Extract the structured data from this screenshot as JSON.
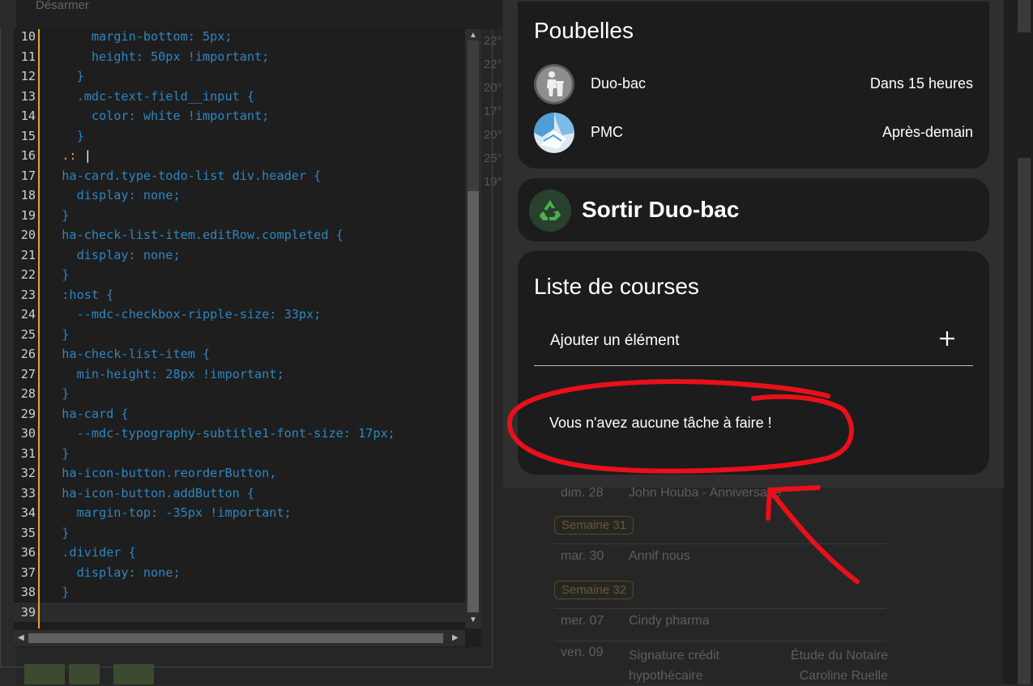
{
  "editor": {
    "lines": [
      {
        "n": "10",
        "text": "      margin-bottom: 5px;"
      },
      {
        "n": "11",
        "text": "      height: 50px !important;"
      },
      {
        "n": "12",
        "text": "    }"
      },
      {
        "n": "13",
        "text": "    .mdc-text-field__input {"
      },
      {
        "n": "14",
        "text": "      color: white !important;"
      },
      {
        "n": "15",
        "text": "    }"
      },
      {
        "n": "16",
        "text": ".: |",
        "prefix": "  "
      },
      {
        "n": "17",
        "text": "  ha-card.type-todo-list div.header {"
      },
      {
        "n": "18",
        "text": "    display: none;"
      },
      {
        "n": "19",
        "text": "  }"
      },
      {
        "n": "20",
        "text": "  ha-check-list-item.editRow.completed {"
      },
      {
        "n": "21",
        "text": "    display: none;"
      },
      {
        "n": "22",
        "text": "  }"
      },
      {
        "n": "23",
        "text": "  :host {"
      },
      {
        "n": "24",
        "text": "    --mdc-checkbox-ripple-size: 33px;"
      },
      {
        "n": "25",
        "text": "  }"
      },
      {
        "n": "26",
        "text": "  ha-check-list-item {"
      },
      {
        "n": "27",
        "text": "    min-height: 28px !important;"
      },
      {
        "n": "28",
        "text": "  }"
      },
      {
        "n": "29",
        "text": "  ha-card {"
      },
      {
        "n": "30",
        "text": "    --mdc-typography-subtitle1-font-size: 17px;"
      },
      {
        "n": "31",
        "text": "  }"
      },
      {
        "n": "32",
        "text": "  ha-icon-button.reorderButton,"
      },
      {
        "n": "33",
        "text": "  ha-icon-button.addButton {"
      },
      {
        "n": "34",
        "text": "    margin-top: -35px !important;"
      },
      {
        "n": "35",
        "text": "  }"
      },
      {
        "n": "36",
        "text": "  .divider {"
      },
      {
        "n": "37",
        "text": "    display: none;"
      },
      {
        "n": "38",
        "text": "  }"
      },
      {
        "n": "39",
        "text": ""
      }
    ]
  },
  "background": {
    "topbar_label": "Désarmer",
    "temps": [
      "22°",
      "22°",
      "20°",
      "17°",
      "20°",
      "25°",
      "19°"
    ],
    "agenda": {
      "row1": {
        "date": "dim. 28",
        "title": "John Houba - Anniversaire"
      },
      "week31": "Semaine 31",
      "row2": {
        "date": "mar. 30",
        "title": "Annif nous"
      },
      "week32": "Semaine 32",
      "row3": {
        "date": "mer. 07",
        "title": "Cindy pharma"
      },
      "row4": {
        "date": "ven. 09",
        "title": "Signature crédit hypothécaire",
        "location": "Étude du Notaire Caroline Ruelle"
      }
    }
  },
  "trash_card": {
    "title": "Poubelles",
    "items": [
      {
        "label": "Duo-bac",
        "value": "Dans 15 heures"
      },
      {
        "label": "PMC",
        "value": "Après-demain"
      }
    ]
  },
  "reminder_card": {
    "title": "Sortir Duo-bac"
  },
  "shopping_card": {
    "title": "Liste de courses",
    "add_placeholder": "Ajouter un élément",
    "empty_message": "Vous n'avez aucune tâche à faire !"
  },
  "colors": {
    "accent_orange": "#e6a23c",
    "code_blue": "#2e86c1",
    "annotation_red": "#e8101a",
    "recycle_green": "#4caf50"
  }
}
